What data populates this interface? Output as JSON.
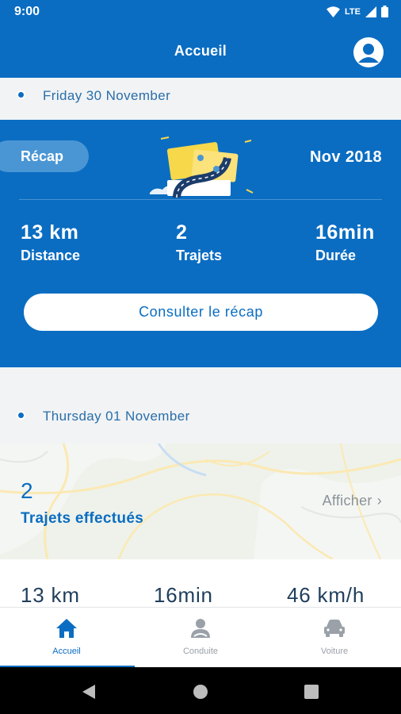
{
  "status_bar": {
    "time": "9:00",
    "network": "LTE"
  },
  "app_bar": {
    "title": "Accueil"
  },
  "timeline": [
    {
      "date": "Friday 30 November"
    },
    {
      "date": "Thursday 01 November"
    }
  ],
  "recap": {
    "badge": "Récap",
    "month": "Nov 2018",
    "stats": [
      {
        "value": "13 km",
        "label": "Distance"
      },
      {
        "value": "2",
        "label": "Trajets"
      },
      {
        "value": "16min",
        "label": "Durée"
      }
    ],
    "button": "Consulter le récap"
  },
  "trip_card": {
    "count": "2",
    "count_label": "Trajets effectués",
    "show_link": "Afficher",
    "stats": [
      "13 km",
      "16min",
      "46 km/h"
    ]
  },
  "bottom_nav": {
    "items": [
      {
        "label": "Accueil",
        "icon": "home-icon",
        "active": true
      },
      {
        "label": "Conduite",
        "icon": "driver-icon",
        "active": false
      },
      {
        "label": "Voiture",
        "icon": "car-icon",
        "active": false
      }
    ]
  },
  "colors": {
    "primary": "#0a6dc2",
    "pill": "#4a96d4",
    "background": "#f1f3f5"
  }
}
